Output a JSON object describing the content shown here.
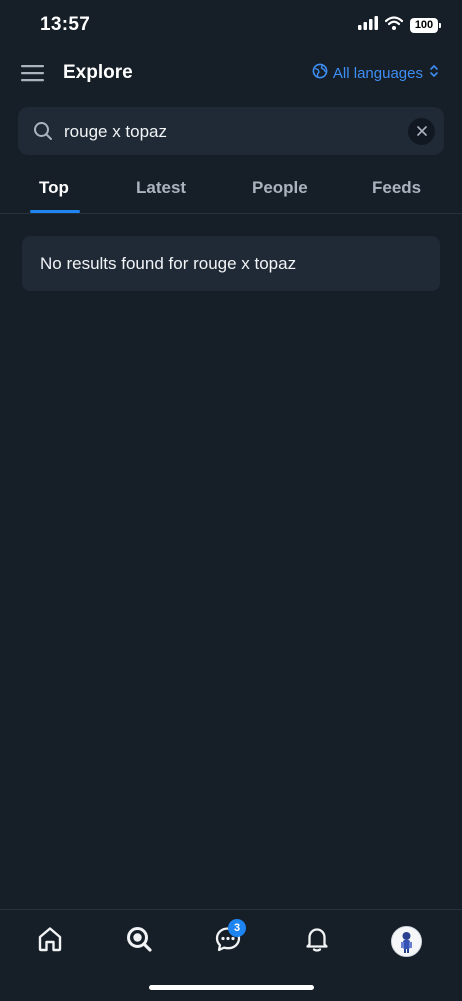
{
  "status_bar": {
    "time": "13:57",
    "battery": "100",
    "icons": [
      "signal-icon",
      "wifi-icon",
      "battery-icon"
    ]
  },
  "header": {
    "title": "Explore",
    "language_select": "All languages",
    "icons": [
      "menu-icon",
      "globe-icon",
      "chevron-up-down-icon"
    ]
  },
  "search": {
    "value": "rouge x topaz",
    "placeholder": "Search"
  },
  "tabs": [
    {
      "label": "Top",
      "active": true
    },
    {
      "label": "Latest",
      "active": false
    },
    {
      "label": "People",
      "active": false
    },
    {
      "label": "Feeds",
      "active": false
    }
  ],
  "results": {
    "empty_message": "No results found for rouge x topaz"
  },
  "bottom_nav": {
    "items": [
      "home",
      "search",
      "messages",
      "notifications",
      "profile"
    ],
    "messages_badge": "3"
  },
  "colors": {
    "background": "#161e27",
    "surface": "#1f2a36",
    "accent": "#1d84f2",
    "link": "#3d8ff5",
    "text": "#f1f3f5",
    "muted": "#aab4bf"
  }
}
